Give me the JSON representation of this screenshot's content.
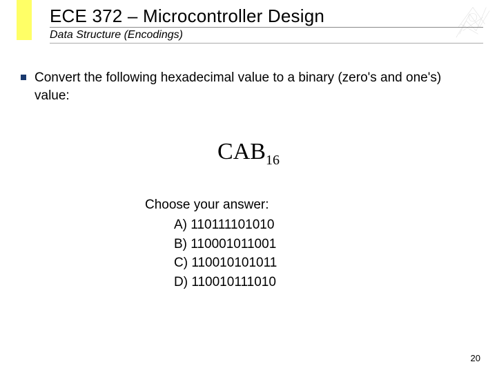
{
  "header": {
    "title": "ECE 372 – Microcontroller Design",
    "subtitle": "Data Structure (Encodings)"
  },
  "question": {
    "prompt": "Convert the following hexadecimal value to a binary (zero's and one's) value:",
    "value_main": "CAB",
    "value_sub": "16"
  },
  "answers": {
    "prompt": "Choose your answer:",
    "options": [
      "A) 110111101010",
      "B) 110001011001",
      "C) 110010101011",
      "D) 110010111010"
    ]
  },
  "slide_number": "20"
}
